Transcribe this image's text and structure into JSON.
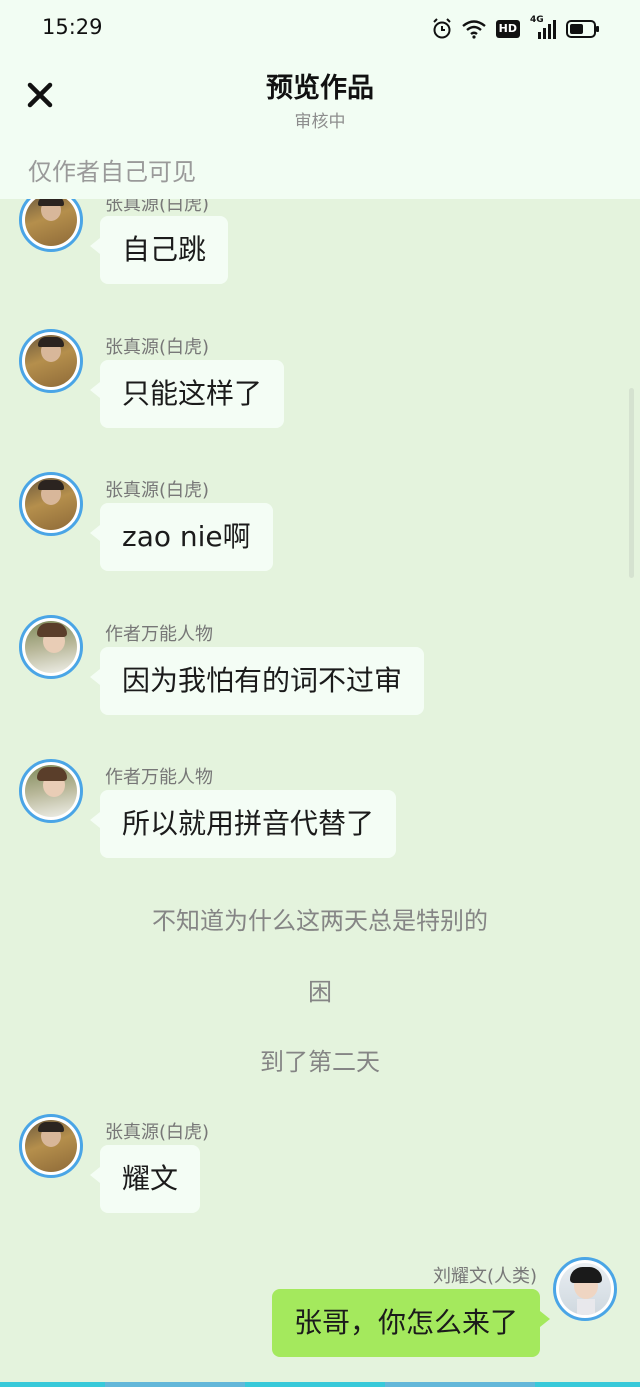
{
  "status_bar": {
    "time": "15:29",
    "signal_type": "4G",
    "hd_label": "HD",
    "icons": [
      "alarm-icon",
      "wifi-icon",
      "hd-icon",
      "signal-icon",
      "battery-icon"
    ]
  },
  "header": {
    "title": "预览作品",
    "subtitle": "审核中",
    "visibility_note": "仅作者自己可见",
    "close_icon": "close-icon"
  },
  "messages": [
    {
      "type": "bubble",
      "side": "left",
      "speaker": "张真源(白虎)",
      "text": "自己跳",
      "avatar": "avatar-zhang"
    },
    {
      "type": "bubble",
      "side": "left",
      "speaker": "张真源(白虎)",
      "text": "只能这样了",
      "avatar": "avatar-zhang"
    },
    {
      "type": "bubble",
      "side": "left",
      "speaker": "张真源(白虎)",
      "text": "zao nie啊",
      "avatar": "avatar-zhang"
    },
    {
      "type": "bubble",
      "side": "left",
      "speaker": "作者万能人物",
      "text": "因为我怕有的词不过审",
      "avatar": "avatar-author"
    },
    {
      "type": "bubble",
      "side": "left",
      "speaker": "作者万能人物",
      "text": "所以就用拼音代替了",
      "avatar": "avatar-author"
    },
    {
      "type": "narration",
      "text": "不知道为什么这两天总是特别的"
    },
    {
      "type": "narration",
      "text": "困"
    },
    {
      "type": "narration",
      "text": "到了第二天"
    },
    {
      "type": "bubble",
      "side": "left",
      "speaker": "张真源(白虎)",
      "text": "耀文",
      "avatar": "avatar-zhang"
    },
    {
      "type": "bubble",
      "side": "right",
      "speaker": "刘耀文(人类)",
      "text": "张哥，你怎么来了",
      "avatar": "avatar-liu"
    }
  ],
  "colors": {
    "background": "#e4f3dd",
    "header_bg": "#f2fdf3",
    "bubble_left": "#f4fdf5",
    "bubble_right": "#a4e95d",
    "avatar_ring": "#4aa5e6"
  }
}
